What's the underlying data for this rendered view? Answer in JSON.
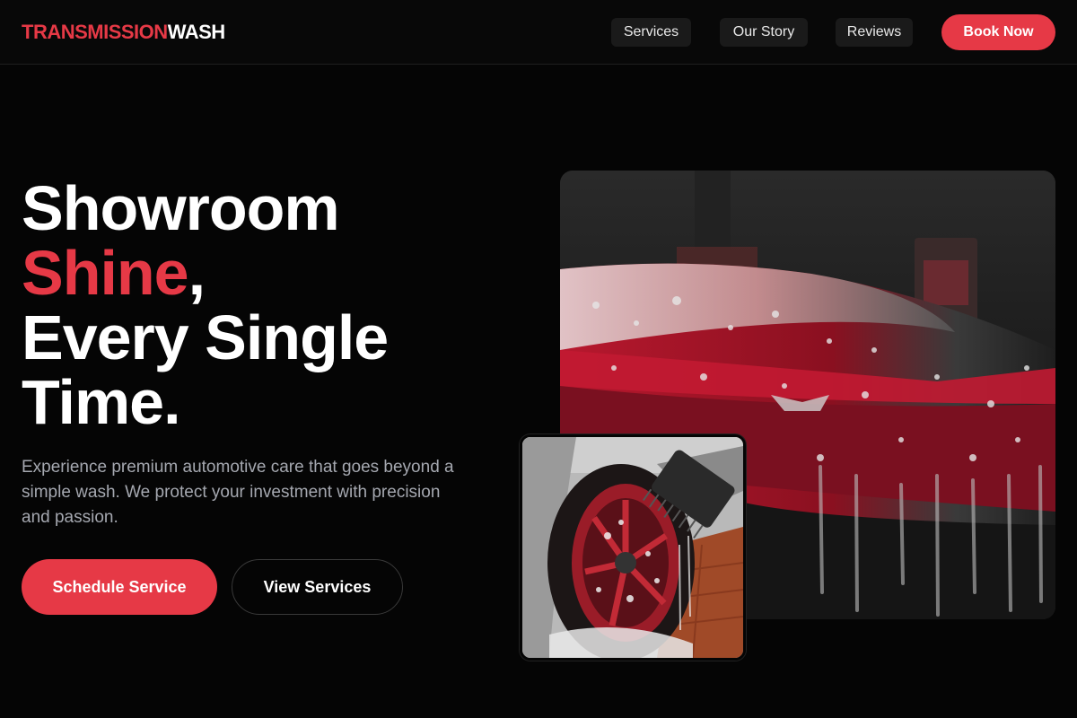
{
  "brand": {
    "part1": "TRANSMISSION",
    "part2": "WASH",
    "accent_color": "#e63946"
  },
  "nav": {
    "items": [
      {
        "label": "Services"
      },
      {
        "label": "Our Story"
      },
      {
        "label": "Reviews"
      }
    ],
    "cta_label": "Book Now"
  },
  "hero": {
    "headline_line1": "Showroom",
    "headline_accent": "Shine",
    "headline_comma": ",",
    "headline_line3": "Every Single",
    "headline_line4": "Time.",
    "description": "Experience premium automotive care that goes beyond a simple wash. We protect your investment with precision and passion.",
    "primary_cta": "Schedule Service",
    "secondary_cta": "View Services"
  }
}
